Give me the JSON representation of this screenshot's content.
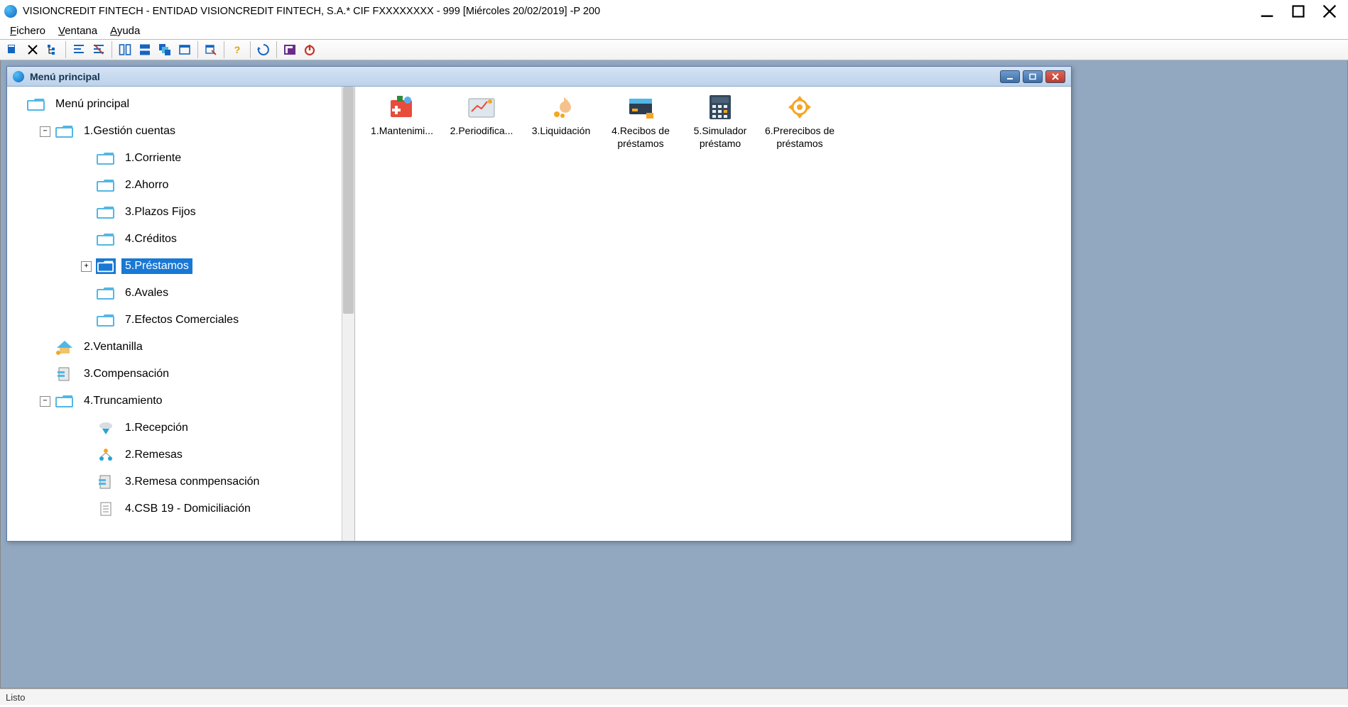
{
  "window": {
    "title": "VISIONCREDIT FINTECH - ENTIDAD VISIONCREDIT FINTECH, S.A.* CIF FXXXXXXXX - 999 [Miércoles 20/02/2019] -P 200"
  },
  "menubar": {
    "items": [
      {
        "label": "Fichero",
        "accel": "F"
      },
      {
        "label": "Ventana",
        "accel": "V"
      },
      {
        "label": "Ayuda",
        "accel": "A"
      }
    ]
  },
  "toolbar": {
    "groups": [
      [
        "open-db-icon",
        "close-icon",
        "tree-icon"
      ],
      [
        "align-left-icon",
        "align-strike-icon"
      ],
      [
        "split-v-icon",
        "split-h-icon",
        "cascade-icon",
        "window-icon"
      ],
      [
        "inspect-icon"
      ],
      [
        "help-icon"
      ],
      [
        "refresh-icon"
      ],
      [
        "app-brand-icon",
        "power-icon"
      ]
    ]
  },
  "child_window": {
    "title": "Menú principal"
  },
  "tree": {
    "root": "Menú principal",
    "items": [
      {
        "depth": 0,
        "expander": "minus",
        "icon": "folder",
        "label": "1.Gestión cuentas"
      },
      {
        "depth": 1,
        "expander": "none",
        "icon": "folder",
        "label": "1.Corriente"
      },
      {
        "depth": 1,
        "expander": "none",
        "icon": "folder",
        "label": "2.Ahorro"
      },
      {
        "depth": 1,
        "expander": "none",
        "icon": "folder",
        "label": "3.Plazos Fijos"
      },
      {
        "depth": 1,
        "expander": "none",
        "icon": "folder",
        "label": "4.Créditos"
      },
      {
        "depth": 1,
        "expander": "plus",
        "icon": "folder-selected",
        "label": "5.Préstamos",
        "selected": true
      },
      {
        "depth": 1,
        "expander": "none",
        "icon": "folder",
        "label": "6.Avales"
      },
      {
        "depth": 1,
        "expander": "none",
        "icon": "folder",
        "label": "7.Efectos Comerciales"
      },
      {
        "depth": 0,
        "expander": "none",
        "icon": "house",
        "label": "2.Ventanilla"
      },
      {
        "depth": 0,
        "expander": "none",
        "icon": "doc",
        "label": "3.Compensación"
      },
      {
        "depth": 0,
        "expander": "minus",
        "icon": "folder",
        "label": "4.Truncamiento"
      },
      {
        "depth": 1,
        "expander": "none",
        "icon": "cloud",
        "label": "1.Recepción"
      },
      {
        "depth": 1,
        "expander": "none",
        "icon": "people",
        "label": "2.Remesas"
      },
      {
        "depth": 1,
        "expander": "none",
        "icon": "doc",
        "label": "3.Remesa conmpensación"
      },
      {
        "depth": 1,
        "expander": "none",
        "icon": "page",
        "label": "4.CSB 19 - Domiciliación"
      }
    ]
  },
  "content": {
    "items": [
      {
        "icon": "maintain-icon",
        "label": "1.Mantenimi..."
      },
      {
        "icon": "period-icon",
        "label": "2.Periodifica..."
      },
      {
        "icon": "liquid-icon",
        "label": "3.Liquidación"
      },
      {
        "icon": "receipts-icon",
        "label": "4.Recibos de préstamos"
      },
      {
        "icon": "simulator-icon",
        "label": "5.Simulador préstamo"
      },
      {
        "icon": "pre-icon",
        "label": "6.Prerecibos de préstamos"
      }
    ]
  },
  "statusbar": {
    "text": "Listo"
  },
  "colors": {
    "mdi_bg": "#92a8c1",
    "select_bg": "#1978d4",
    "folder": "#52b7e6"
  }
}
